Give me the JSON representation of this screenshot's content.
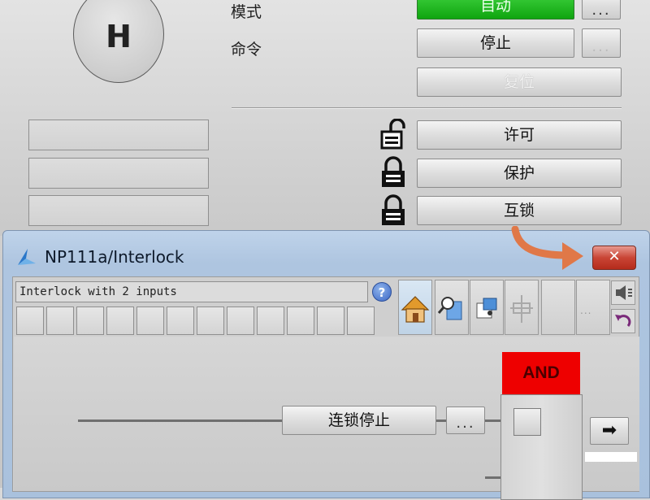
{
  "faceplate": {
    "mode_label": "模式",
    "command_label": "命令",
    "mode_button": "自动",
    "stop_button": "停止",
    "reset_button": "复位",
    "permit_button": "许可",
    "protect_button": "保护",
    "interlock_button": "互锁",
    "more_label": "...",
    "motor_symbol": "H"
  },
  "window": {
    "title": "NP111a/Interlock",
    "close_label": "✕",
    "description": "Interlock with 2 inputs",
    "help_label": "?"
  },
  "logic": {
    "input_label": "连锁停止",
    "input_more": "...",
    "gate_label": "AND",
    "output_arrow": "➡"
  },
  "colors": {
    "mode_active": "#12b012",
    "and_gate": "#ee0000",
    "callout_arrow": "#e07848",
    "close_button": "#c94535"
  },
  "icons": [
    "home-icon",
    "search-docs-icon",
    "pin-icon",
    "disabled-symbol-icon",
    "speaker-icon",
    "undo-icon",
    "lock-open-icon",
    "lock-closed-icon"
  ]
}
